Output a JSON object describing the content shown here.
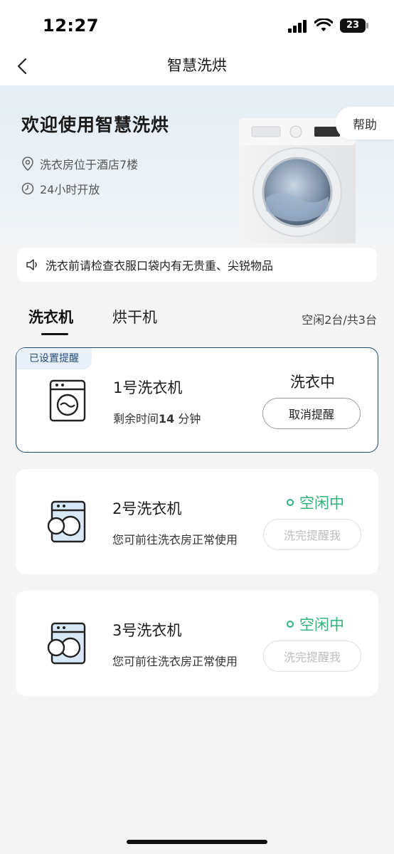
{
  "status_bar": {
    "time": "12:27",
    "battery": "23"
  },
  "nav": {
    "title": "智慧洗烘",
    "back_icon": "chevron-left-icon"
  },
  "hero": {
    "title": "欢迎使用智慧洗烘",
    "location": "洗衣房位于酒店7楼",
    "hours": "24小时开放",
    "help_label": "帮助"
  },
  "notice": {
    "text": "洗衣前请检查衣服口袋内有无贵重、尖锐物品",
    "icon": "speaker-icon"
  },
  "tabs": {
    "items": [
      {
        "label": "洗衣机",
        "active": true
      },
      {
        "label": "烘干机",
        "active": false
      }
    ],
    "availability": "空闲2台/共3台"
  },
  "machines": [
    {
      "badge": "已设置提醒",
      "name": "1号洗衣机",
      "sub_prefix": "剩余时间",
      "sub_value": "14",
      "sub_suffix": "分钟",
      "status": "洗衣中",
      "button": "取消提醒"
    },
    {
      "name": "2号洗衣机",
      "sub": "您可前往洗衣房正常使用",
      "status": "空闲中",
      "button": "洗完提醒我"
    },
    {
      "name": "3号洗衣机",
      "sub": "您可前往洗衣房正常使用",
      "status": "空闲中",
      "button": "洗完提醒我"
    }
  ],
  "colors": {
    "idle": "#2db37a",
    "accent_border": "#1e4a6e",
    "badge_bg": "#e7eff8"
  }
}
